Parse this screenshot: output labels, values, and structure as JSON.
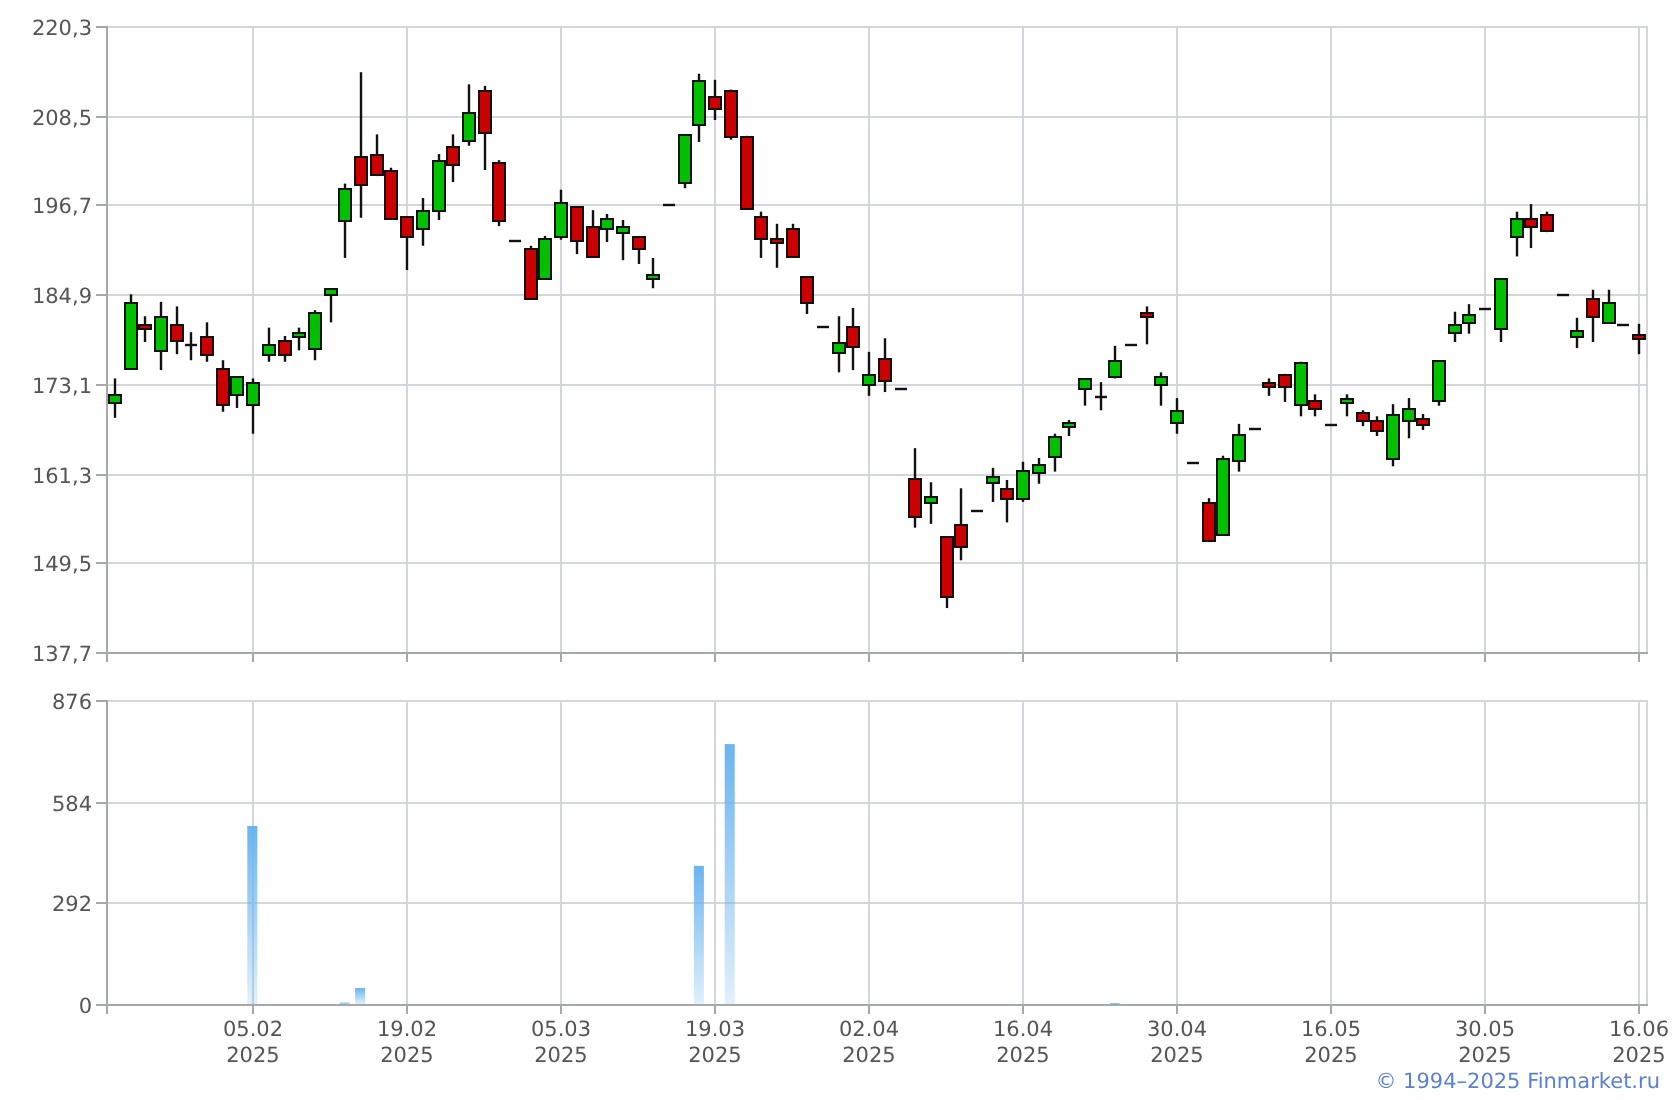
{
  "price_chart": {
    "chart_data": {
      "type": "candlestick",
      "grid": true,
      "categories": [
        null,
        null,
        null,
        null,
        null,
        null,
        null,
        null,
        null,
        null,
        null,
        null,
        null,
        null,
        null,
        null,
        null,
        null,
        null,
        null,
        null,
        null,
        null,
        null,
        null,
        null,
        null,
        null,
        null,
        null,
        null,
        null,
        null,
        null,
        null,
        null,
        null,
        null,
        null,
        null,
        null,
        null,
        null,
        null,
        null,
        null,
        null,
        null,
        null,
        null,
        null,
        null,
        null,
        null,
        null,
        null,
        null,
        null,
        null,
        null,
        null,
        null,
        null,
        null,
        null,
        null,
        null,
        null,
        null,
        null,
        null,
        null,
        null,
        null,
        null,
        null,
        null,
        null,
        null,
        null,
        null,
        null,
        null,
        null,
        null,
        null,
        null,
        null,
        null,
        null,
        null,
        null,
        null,
        null,
        null,
        null,
        null,
        null,
        null,
        null
      ],
      "ylim": [
        137.7,
        220.3
      ],
      "yticks": [
        {
          "value": 137.7,
          "label": "137,7"
        },
        {
          "value": 149.5,
          "label": "149,5"
        },
        {
          "value": 161.3,
          "label": "161,3"
        },
        {
          "value": 173.1,
          "label": "173,1"
        },
        {
          "value": 184.9,
          "label": "184,9"
        },
        {
          "value": 196.7,
          "label": "196,7"
        },
        {
          "value": 208.5,
          "label": "208,5"
        },
        {
          "value": 220.3,
          "label": "220,3"
        }
      ],
      "ohlc": [
        [
          170.7,
          173.8,
          168.6,
          171.7
        ],
        [
          175.2,
          184.9,
          175.2,
          183.9
        ],
        [
          181.0,
          182.0,
          178.6,
          180.5
        ],
        [
          177.5,
          183.9,
          174.9,
          182.0
        ],
        [
          181.0,
          183.3,
          177.0,
          178.9
        ],
        [
          178.3,
          179.9,
          176.2,
          178.3
        ],
        [
          179.4,
          181.2,
          176.0,
          177.0
        ],
        [
          175.2,
          176.2,
          169.4,
          170.4
        ],
        [
          171.7,
          174.1,
          169.9,
          174.1
        ],
        [
          170.4,
          173.8,
          166.5,
          173.3
        ],
        [
          177.0,
          180.5,
          176.0,
          178.3
        ],
        [
          178.9,
          179.4,
          176.0,
          177.0
        ],
        [
          179.4,
          180.5,
          177.5,
          179.9
        ],
        [
          177.8,
          182.8,
          176.2,
          182.6
        ],
        [
          184.9,
          185.7,
          181.2,
          185.7
        ],
        [
          194.7,
          199.5,
          189.7,
          198.9
        ],
        [
          203.2,
          214.2,
          195.0,
          199.5
        ],
        [
          203.4,
          206.0,
          200.5,
          200.8
        ],
        [
          201.3,
          201.6,
          195.0,
          195.0
        ],
        [
          195.2,
          195.2,
          188.1,
          192.6
        ],
        [
          193.6,
          197.6,
          191.3,
          196.0
        ],
        [
          196.0,
          203.4,
          194.7,
          202.6
        ],
        [
          204.5,
          206.0,
          199.7,
          202.1
        ],
        [
          205.3,
          212.6,
          204.5,
          209.0
        ],
        [
          211.9,
          212.4,
          201.3,
          206.3
        ],
        [
          202.4,
          202.6,
          193.9,
          194.7
        ],
        [
          192.1,
          192.1,
          192.1,
          192.1
        ],
        [
          191.0,
          191.3,
          184.4,
          184.4
        ],
        [
          187.0,
          192.6,
          186.8,
          192.3
        ],
        [
          192.6,
          198.7,
          192.1,
          197.1
        ],
        [
          196.5,
          196.5,
          190.2,
          192.1
        ],
        [
          193.9,
          196.0,
          189.9,
          189.9
        ],
        [
          193.6,
          195.5,
          191.8,
          195.0
        ],
        [
          193.1,
          194.7,
          189.4,
          193.9
        ],
        [
          192.6,
          192.6,
          188.9,
          191.0
        ],
        [
          187.0,
          189.7,
          185.7,
          187.6
        ],
        [
          196.8,
          196.8,
          196.8,
          196.8
        ],
        [
          199.7,
          206.0,
          198.9,
          206.0
        ],
        [
          207.4,
          214.0,
          205.0,
          213.2
        ],
        [
          211.1,
          213.2,
          207.9,
          209.5
        ],
        [
          211.9,
          211.9,
          205.3,
          205.8
        ],
        [
          205.8,
          205.8,
          196.3,
          196.3
        ],
        [
          195.2,
          195.8,
          189.7,
          192.3
        ],
        [
          192.3,
          194.2,
          188.4,
          191.8
        ],
        [
          193.6,
          194.2,
          189.7,
          189.9
        ],
        [
          187.3,
          187.3,
          182.3,
          183.9
        ],
        [
          180.7,
          180.7,
          180.7,
          180.7
        ],
        [
          177.3,
          182.0,
          174.6,
          178.6
        ],
        [
          180.7,
          183.1,
          174.9,
          178.1
        ],
        [
          173.1,
          177.3,
          171.5,
          174.4
        ],
        [
          176.5,
          179.1,
          172.0,
          173.6
        ],
        [
          172.5,
          172.5,
          172.5,
          172.5
        ],
        [
          160.7,
          164.6,
          154.1,
          155.6
        ],
        [
          157.5,
          160.1,
          154.6,
          158.3
        ],
        [
          153.0,
          153.0,
          143.5,
          145.1
        ],
        [
          154.6,
          159.3,
          149.8,
          151.7
        ],
        [
          156.4,
          156.4,
          156.4,
          156.4
        ],
        [
          160.1,
          162.0,
          157.5,
          160.9
        ],
        [
          159.3,
          160.4,
          154.8,
          158.0
        ],
        [
          158.0,
          162.8,
          157.5,
          161.7
        ],
        [
          161.5,
          163.3,
          159.9,
          162.5
        ],
        [
          163.6,
          166.5,
          161.5,
          166.2
        ],
        [
          167.5,
          168.3,
          166.2,
          168.1
        ],
        [
          172.5,
          173.8,
          170.2,
          173.8
        ],
        [
          171.5,
          173.3,
          169.6,
          171.5
        ],
        [
          174.1,
          178.1,
          173.8,
          176.2
        ],
        [
          178.3,
          178.3,
          178.3,
          178.3
        ],
        [
          182.6,
          183.3,
          178.3,
          182.0
        ],
        [
          173.1,
          174.6,
          170.2,
          174.1
        ],
        [
          168.1,
          171.2,
          166.5,
          169.6
        ],
        [
          162.8,
          162.8,
          162.8,
          162.8
        ],
        [
          157.5,
          158.0,
          152.2,
          152.5
        ],
        [
          153.3,
          163.6,
          153.3,
          163.3
        ],
        [
          163.0,
          167.8,
          161.5,
          166.5
        ],
        [
          167.2,
          167.2,
          167.2,
          167.2
        ],
        [
          173.3,
          173.8,
          171.5,
          172.8
        ],
        [
          174.4,
          174.4,
          170.7,
          172.8
        ],
        [
          170.4,
          176.0,
          168.8,
          176.0
        ],
        [
          171.0,
          171.7,
          168.8,
          169.9
        ],
        [
          167.8,
          167.8,
          167.8,
          167.8
        ],
        [
          170.7,
          171.7,
          168.8,
          171.2
        ],
        [
          169.4,
          169.6,
          167.5,
          168.3
        ],
        [
          168.3,
          168.8,
          166.2,
          167.0
        ],
        [
          163.3,
          170.4,
          162.2,
          169.1
        ],
        [
          168.3,
          171.2,
          165.9,
          169.9
        ],
        [
          168.6,
          169.1,
          167.0,
          167.8
        ],
        [
          171.0,
          176.2,
          170.2,
          176.2
        ],
        [
          179.9,
          182.6,
          178.6,
          181.0
        ],
        [
          181.2,
          183.6,
          179.7,
          182.3
        ],
        [
          183.1,
          183.1,
          183.1,
          183.1
        ],
        [
          180.5,
          187.0,
          178.6,
          187.0
        ],
        [
          192.6,
          195.8,
          189.9,
          195.0
        ],
        [
          195.0,
          196.8,
          191.0,
          193.9
        ],
        [
          195.5,
          195.8,
          193.1,
          193.4
        ],
        [
          184.9,
          184.9,
          184.9,
          184.9
        ],
        [
          179.4,
          181.8,
          177.8,
          180.2
        ],
        [
          184.4,
          185.5,
          178.6,
          182.0
        ],
        [
          181.2,
          185.5,
          181.2,
          183.9
        ],
        [
          181.0,
          181.0,
          181.0,
          181.0
        ],
        [
          179.7,
          181.0,
          177.0,
          179.1
        ]
      ]
    }
  },
  "volume_chart": {
    "chart_data": {
      "type": "bar",
      "grid": true,
      "categories": [
        null,
        null,
        null,
        null,
        null,
        null,
        null,
        null,
        null,
        "05.02\n2025",
        null,
        null,
        null,
        null,
        null,
        null,
        null,
        null,
        null,
        "19.02\n2025",
        null,
        null,
        null,
        null,
        null,
        null,
        null,
        null,
        null,
        "05.03\n2025",
        null,
        null,
        null,
        null,
        null,
        null,
        null,
        null,
        null,
        "19.03\n2025",
        null,
        null,
        null,
        null,
        null,
        null,
        null,
        null,
        null,
        "02.04\n2025",
        null,
        null,
        null,
        null,
        null,
        null,
        null,
        null,
        null,
        "16.04\n2025",
        null,
        null,
        null,
        null,
        null,
        null,
        null,
        null,
        null,
        "30.04\n2025",
        null,
        null,
        null,
        null,
        null,
        null,
        null,
        null,
        null,
        "16.05\n2025",
        null,
        null,
        null,
        null,
        null,
        null,
        null,
        null,
        null,
        "30.05\n2025",
        null,
        null,
        null,
        null,
        null,
        null,
        null,
        null,
        null,
        "16.06\n2025"
      ],
      "ylim": [
        0,
        876
      ],
      "yticks": [
        0,
        292,
        584,
        876
      ],
      "values": [
        0,
        0,
        0,
        0,
        0,
        0,
        0,
        0,
        0,
        513,
        0,
        0,
        0,
        0,
        0,
        4,
        46,
        0,
        0,
        0,
        0,
        0,
        0,
        0,
        0,
        0,
        0,
        0,
        0,
        0,
        0,
        0,
        0,
        0,
        0,
        0,
        0,
        0,
        398,
        0,
        749,
        0,
        0,
        0,
        0,
        0,
        0,
        0,
        0,
        0,
        0,
        0,
        0,
        0,
        0,
        0,
        0,
        0,
        0,
        0,
        0,
        0,
        0,
        0,
        0,
        3,
        0,
        0,
        0,
        0,
        0,
        0,
        0,
        0,
        0,
        0,
        0,
        0,
        0,
        0,
        0,
        0,
        0,
        0,
        0,
        0,
        0,
        0,
        0,
        0,
        0,
        0,
        0,
        0,
        0,
        0,
        0,
        0,
        0,
        0
      ]
    }
  },
  "footer": {
    "copyright": "© 1994–2025 Finmarket.ru"
  }
}
